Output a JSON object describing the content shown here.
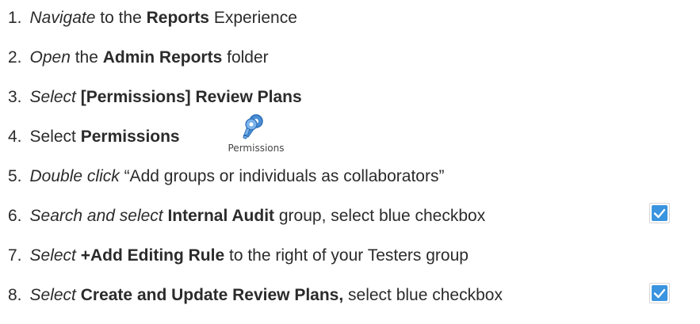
{
  "steps": [
    {
      "num": "1.",
      "parts": [
        {
          "t": "Navigate",
          "s": "it"
        },
        {
          "t": " to the ",
          "s": ""
        },
        {
          "t": "Reports",
          "s": "b"
        },
        {
          "t": " Experience",
          "s": ""
        }
      ]
    },
    {
      "num": "2.",
      "parts": [
        {
          "t": "Open",
          "s": "it"
        },
        {
          "t": " the ",
          "s": ""
        },
        {
          "t": "Admin Reports",
          "s": "b"
        },
        {
          "t": " folder",
          "s": ""
        }
      ]
    },
    {
      "num": "3.",
      "parts": [
        {
          "t": "Select",
          "s": "it"
        },
        {
          "t": " ",
          "s": ""
        },
        {
          "t": "[Permissions] Review Plans",
          "s": "b"
        }
      ]
    },
    {
      "num": "4.",
      "parts": [
        {
          "t": "Select ",
          "s": ""
        },
        {
          "t": "Permissions",
          "s": "b"
        }
      ]
    },
    {
      "num": "5.",
      "parts": [
        {
          "t": "Double click",
          "s": "it"
        },
        {
          "t": " “Add groups or individuals as collaborators”",
          "s": ""
        }
      ]
    },
    {
      "num": "6.",
      "parts": [
        {
          "t": "Search and select",
          "s": "it"
        },
        {
          "t": " ",
          "s": ""
        },
        {
          "t": "Internal Audit",
          "s": "b"
        },
        {
          "t": " group, select blue checkbox",
          "s": ""
        }
      ]
    },
    {
      "num": "7.",
      "parts": [
        {
          "t": "Select",
          "s": "it"
        },
        {
          "t": " ",
          "s": ""
        },
        {
          "t": "+Add Editing Rule",
          "s": "b"
        },
        {
          "t": " to the right of your Testers group",
          "s": ""
        }
      ]
    },
    {
      "num": "8.",
      "parts": [
        {
          "t": "Select",
          "s": "it"
        },
        {
          "t": " ",
          "s": ""
        },
        {
          "t": "Create and Update Review Plans,",
          "s": "b"
        },
        {
          "t": " select blue checkbox",
          "s": ""
        }
      ]
    }
  ],
  "permissions_icon": {
    "name": "permissions-key-icon",
    "label": "Permissions"
  },
  "checkbox": {
    "icon": "checkmark-icon",
    "checked": true,
    "color": "#3a94e0"
  }
}
